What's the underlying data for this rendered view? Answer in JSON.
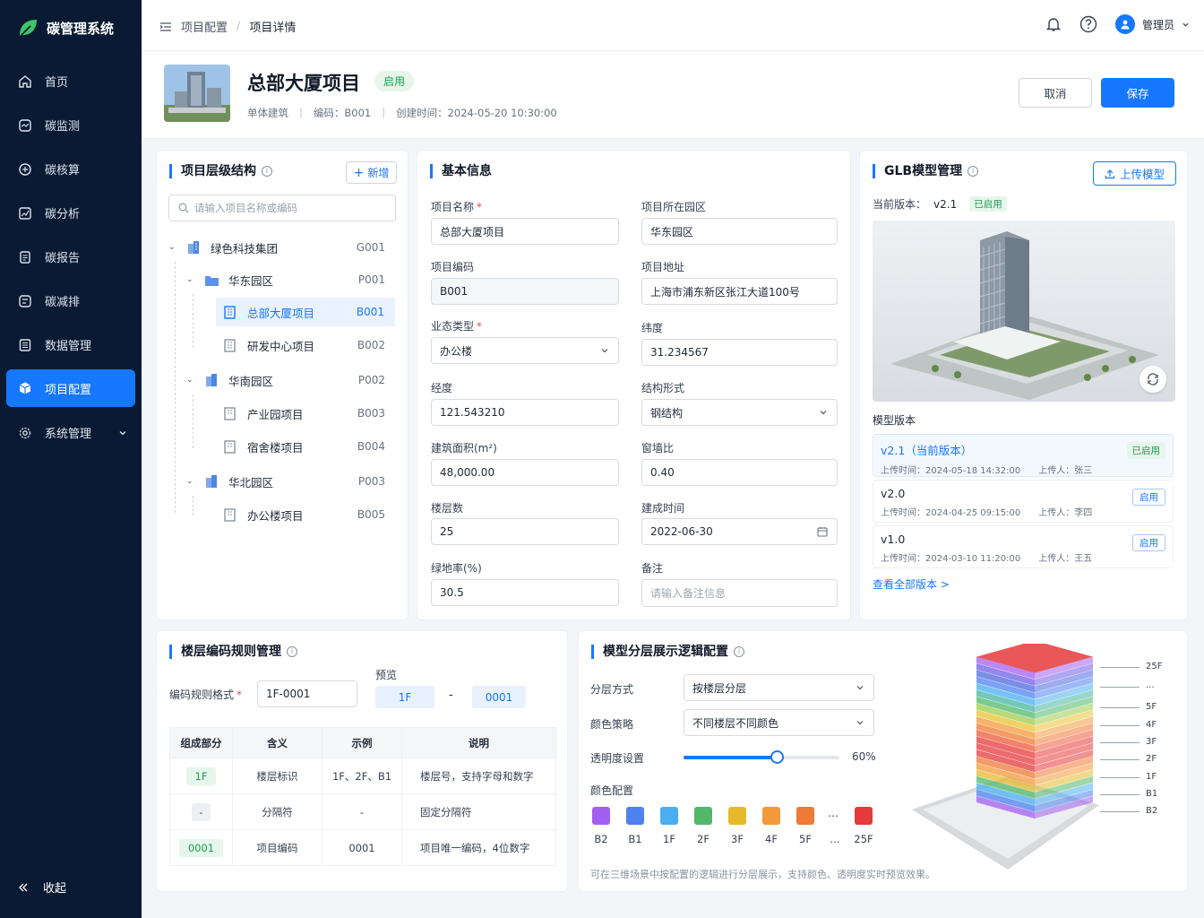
{
  "app": {
    "name": "碳管理系统",
    "accent": "#1677ff",
    "sidebar_bg": "#0b1a33"
  },
  "nav": {
    "items": [
      {
        "label": "首页",
        "icon": "home-icon"
      },
      {
        "label": "碳监测",
        "icon": "monitor-icon"
      },
      {
        "label": "碳核算",
        "icon": "calculate-icon"
      },
      {
        "label": "碳分析",
        "icon": "chart-icon"
      },
      {
        "label": "碳报告",
        "icon": "report-icon"
      },
      {
        "label": "碳减排",
        "icon": "reduce-icon"
      },
      {
        "label": "数据管理",
        "icon": "data-icon"
      },
      {
        "label": "项目配置",
        "icon": "cube-icon"
      },
      {
        "label": "系统管理",
        "icon": "gear-icon"
      }
    ],
    "collapse_label": "收起"
  },
  "header": {
    "breadcrumb": [
      "项目配置",
      "项目详情"
    ],
    "breadcrumb_sep": "/",
    "user": "管理员"
  },
  "project": {
    "title": "总部大厦项目",
    "status": "启用",
    "type": "单体建筑",
    "code_label": "编码：",
    "code": "B001",
    "created_label": "创建时间：",
    "created": "2024-05-20 10:30:00",
    "cancel": "取消",
    "save": "保存"
  },
  "tree": {
    "title": "项目层级结构",
    "add": "新增",
    "search_placeholder": "请输入项目名称或编码",
    "rows": [
      {
        "label": "绿色科技集团",
        "code": "G001"
      },
      {
        "label": "华东园区",
        "code": "P001"
      },
      {
        "label": "总部大厦项目",
        "code": "B001"
      },
      {
        "label": "研发中心项目",
        "code": "B002"
      },
      {
        "label": "华南园区",
        "code": "P002"
      },
      {
        "label": "产业园项目",
        "code": "B003"
      },
      {
        "label": "宿舍楼项目",
        "code": "B004"
      },
      {
        "label": "华北园区",
        "code": "P003"
      },
      {
        "label": "办公楼项目",
        "code": "B005"
      }
    ]
  },
  "basic": {
    "title": "基本信息",
    "name_label": "项目名称",
    "name": "总部大厦项目",
    "park_label": "项目所在园区",
    "park": "华东园区",
    "code_label": "项目编码",
    "code": "B001",
    "addr_label": "项目地址",
    "addr": "上海市浦东新区张江大道100号",
    "biz_label": "业态类型",
    "biz": "办公楼",
    "lat_label": "纬度",
    "lat": "31.234567",
    "lng_label": "经度",
    "lng": "121.543210",
    "struct_label": "结构形式",
    "struct": "钢结构",
    "area_label": "建筑面积(m²)",
    "area": "48,000.00",
    "wwr_label": "窗墙比",
    "wwr": "0.40",
    "floors_label": "楼层数",
    "floors": "25",
    "built_label": "建成时间",
    "built": "2022-06-30",
    "green_label": "绿地率(%)",
    "green": "30.5",
    "remark_label": "备注",
    "remark_placeholder": "请输入备注信息"
  },
  "glb": {
    "title": "GLB模型管理",
    "upload": "上传模型",
    "current_label": "当前版本：",
    "current": "v2.1",
    "current_tag": "已启用",
    "versions_title": "模型版本",
    "versions": [
      {
        "name": "v2.1（当前版本）",
        "time": "上传时间：2024-05-18 14:32:00",
        "user": "上传人：张三",
        "tag": "已启用"
      },
      {
        "name": "v2.0",
        "time": "上传时间：2024-04-25 09:15:00",
        "user": "上传人：李四",
        "tag": "启用"
      },
      {
        "name": "v1.0",
        "time": "上传时间：2024-03-10 11:20:00",
        "user": "上传人：王五",
        "tag": "启用"
      }
    ],
    "view_all": "查看全部版本 >"
  },
  "floor_code": {
    "title": "楼层编码规则管理",
    "format_label": "编码规则格式",
    "format": "1F-0001",
    "preview_label": "预览",
    "preview_a": "1F",
    "preview_sep": "-",
    "preview_b": "0001",
    "headers": [
      "组成部分",
      "含义",
      "示例",
      "说明"
    ],
    "rows": [
      {
        "part": "1F",
        "meaning": "楼层标识",
        "example": "1F、2F、B1",
        "desc": "楼层号，支持字母和数字"
      },
      {
        "part": "-",
        "meaning": "分隔符",
        "example": "-",
        "desc": "固定分隔符"
      },
      {
        "part": "0001",
        "meaning": "项目编码",
        "example": "0001",
        "desc": "项目唯一编码，4位数字"
      }
    ]
  },
  "layer": {
    "title": "模型分层展示逻辑配置",
    "mode_label": "分层方式",
    "mode": "按楼层分层",
    "color_label": "颜色策略",
    "color": "不同楼层不同颜色",
    "opacity_label": "透明度设置",
    "opacity": "60%",
    "opacity_value": 0.6,
    "palette_label": "颜色配置",
    "palette": [
      {
        "floor": "B2",
        "color": "#a35ff0"
      },
      {
        "floor": "B1",
        "color": "#4d82f0"
      },
      {
        "floor": "1F",
        "color": "#4aaef0"
      },
      {
        "floor": "2F",
        "color": "#4fb86a"
      },
      {
        "floor": "3F",
        "color": "#e6b92b"
      },
      {
        "floor": "4F",
        "color": "#f29a3a"
      },
      {
        "floor": "5F",
        "color": "#ee7a35"
      },
      {
        "floor": "…",
        "color": ""
      },
      {
        "floor": "25F",
        "color": "#e5393b"
      }
    ],
    "note": "可在三维场景中按配置的逻辑进行分层展示，支持颜色、透明度实时预览效果。",
    "floor_labels": [
      "25F",
      "...",
      "5F",
      "4F",
      "3F",
      "2F",
      "1F",
      "B1",
      "B2"
    ]
  }
}
